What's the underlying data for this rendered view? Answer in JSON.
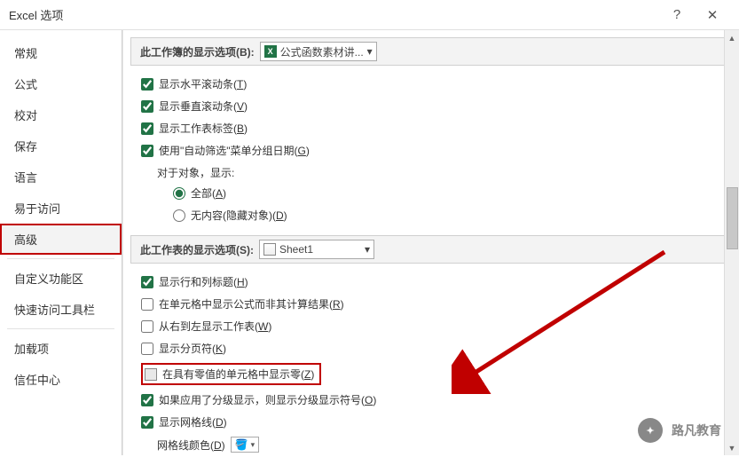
{
  "titlebar": {
    "title": "Excel 选项",
    "help": "?",
    "close": "✕"
  },
  "sidebar": {
    "items": [
      {
        "label": "常规"
      },
      {
        "label": "公式"
      },
      {
        "label": "校对"
      },
      {
        "label": "保存"
      },
      {
        "label": "语言"
      },
      {
        "label": "易于访问"
      },
      {
        "label": "高级",
        "framed": true
      },
      {
        "label": "-"
      },
      {
        "label": "自定义功能区"
      },
      {
        "label": "快速访问工具栏"
      },
      {
        "label": "-"
      },
      {
        "label": "加载项"
      },
      {
        "label": "信任中心"
      }
    ]
  },
  "sectionA": {
    "title": "此工作簿的显示选项(B):",
    "combo": "公式函数素材讲...",
    "rows": {
      "hscroll": {
        "text": "显示水平滚动条(",
        "u": "T",
        "after": ")",
        "checked": true
      },
      "vscroll": {
        "text": "显示垂直滚动条(",
        "u": "V",
        "after": ")",
        "checked": true
      },
      "tabs": {
        "text": "显示工作表标签(",
        "u": "B",
        "after": ")",
        "checked": true
      },
      "autofilter": {
        "text": "使用\"自动筛选\"菜单分组日期(",
        "u": "G",
        "after": ")",
        "checked": true
      },
      "objtitle": "对于对象，显示:",
      "all": {
        "text": "全部(",
        "u": "A",
        "after": ")",
        "checked": true
      },
      "none": {
        "text": "无内容(隐藏对象)(",
        "u": "D",
        "after": ")",
        "checked": false
      }
    }
  },
  "sectionB": {
    "title": "此工作表的显示选项(S):",
    "combo": "Sheet1",
    "rows": {
      "rowcol": {
        "text": "显示行和列标题(",
        "u": "H",
        "after": ")",
        "checked": true
      },
      "formulas": {
        "text": "在单元格中显示公式而非其计算结果(",
        "u": "R",
        "after": ")",
        "checked": false
      },
      "rtl": {
        "text": "从右到左显示工作表(",
        "u": "W",
        "after": ")",
        "checked": false
      },
      "pagebreak": {
        "text": "显示分页符(",
        "u": "K",
        "after": ")",
        "checked": false
      },
      "zero": {
        "text": "在具有零值的单元格中显示零(",
        "u": "Z",
        "after": ")",
        "checked": false
      },
      "outline": {
        "text": "如果应用了分级显示，则显示分级显示符号(",
        "u": "O",
        "after": ")",
        "checked": true
      },
      "grid": {
        "text": "显示网格线(",
        "u": "D",
        "after": ")",
        "checked": true
      },
      "gridcolor": {
        "label": "网格线颜色(",
        "u": "D",
        "after": ")"
      }
    }
  },
  "watermark": {
    "text": "路凡教育"
  }
}
